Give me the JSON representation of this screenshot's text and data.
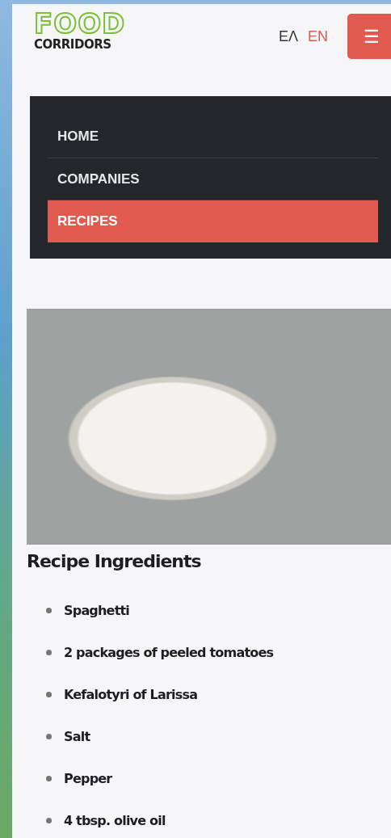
{
  "logo": {
    "top": "FOOD",
    "bottom": "CORRIDORS"
  },
  "languages": [
    {
      "label": "ΕΛ",
      "selected": false
    },
    {
      "label": "EN",
      "selected": true
    }
  ],
  "menu_button": {
    "label": "☰"
  },
  "nav": [
    {
      "label": "HOME",
      "selected": false
    },
    {
      "label": "COMPANIES",
      "selected": false
    },
    {
      "label": "RECIPES",
      "selected": true
    }
  ],
  "recipe": {
    "heading": "Recipe Ingredients",
    "ingredients": [
      "Spaghetti",
      "2 packages of peeled tomatoes",
      "Kefalotyri of Larissa",
      "Salt",
      "Pepper",
      "4 tbsp. olive oil"
    ]
  }
}
